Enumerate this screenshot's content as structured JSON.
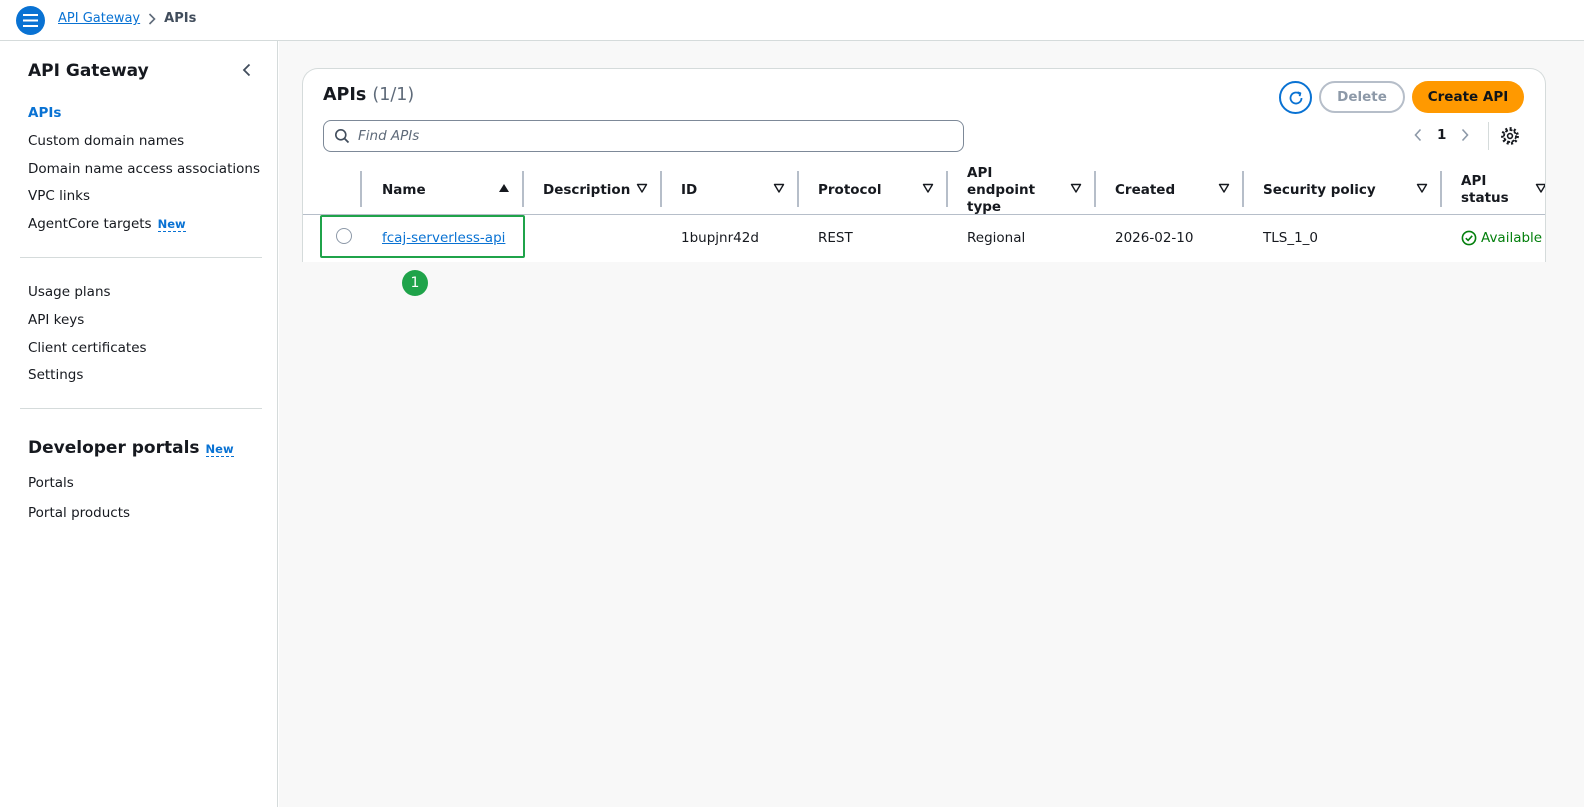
{
  "breadcrumb": {
    "root": "API Gateway",
    "current": "APIs"
  },
  "sidebar": {
    "title": "API Gateway",
    "items": [
      {
        "label": "APIs",
        "active": true
      },
      {
        "label": "Custom domain names"
      },
      {
        "label": "Domain name access associations"
      },
      {
        "label": "VPC links"
      },
      {
        "label": "AgentCore targets",
        "badge": "New"
      }
    ],
    "items2": [
      {
        "label": "Usage plans"
      },
      {
        "label": "API keys"
      },
      {
        "label": "Client certificates"
      },
      {
        "label": "Settings"
      }
    ],
    "developer_portals": {
      "title": "Developer portals",
      "badge": "New"
    },
    "items3": [
      {
        "label": "Portals"
      },
      {
        "label": "Portal products"
      }
    ]
  },
  "panel": {
    "title": "APIs",
    "count": "(1/1)",
    "delete_label": "Delete",
    "create_label": "Create API",
    "search_placeholder": "Find APIs",
    "page": "1"
  },
  "table": {
    "columns": [
      "Name",
      "Description",
      "ID",
      "Protocol",
      "API endpoint type",
      "Created",
      "Security policy",
      "API status"
    ],
    "rows": [
      {
        "name": "fcaj-serverless-api",
        "description": "",
        "id": "1bupjnr42d",
        "protocol": "REST",
        "endpoint_type": "Regional",
        "created": "2026-02-10",
        "security_policy": "TLS_1_0",
        "status": "Available"
      }
    ]
  },
  "annotation": {
    "step": "1"
  },
  "colors": {
    "link": "#0972d3",
    "primary_button": "#ff9900",
    "success": "#037f0c",
    "highlight": "#1fa34a"
  },
  "icons": {
    "menu": "hamburger-menu-icon",
    "breadcrumb_separator": "chevron-right-icon",
    "collapse": "chevron-left-icon",
    "refresh": "refresh-icon",
    "search": "search-icon",
    "prev": "chevron-left-icon",
    "next": "chevron-right-icon",
    "preferences": "gear-icon",
    "sort_asc": "caret-up-filled-icon",
    "sort": "caret-down-outline-icon",
    "status": "check-circle-icon"
  }
}
